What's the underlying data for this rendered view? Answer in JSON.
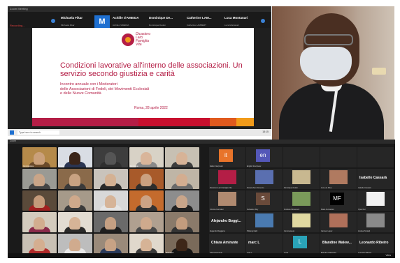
{
  "top_window": {
    "title": "Zoom Meeting",
    "recording": "Recording...",
    "strip": [
      {
        "name": "Michaela Fikar",
        "sub": "Michaela Fikar"
      },
      {
        "name": "M",
        "sub": "Valentino Negreti"
      },
      {
        "name": "Achille d'AMEIDA",
        "sub": "Achille d'AMEIDA"
      },
      {
        "name": "Dominique De...",
        "sub": "Dominique Dedon"
      },
      {
        "name": "Catherine LAM...",
        "sub": "Catherine LAMBERT"
      },
      {
        "name": "Luca Montanari",
        "sub": "Luca Montanari"
      }
    ],
    "slide": {
      "logo_line1": "Dicastero",
      "logo_line2": "Laici",
      "logo_line3": "Famiglia",
      "logo_line4": "Vita",
      "title": "Condizioni lavorative all'interno delle associazioni. Un servizio secondo giustizia e carità",
      "subtitle_1": "Incontro annuale con i Moderatori",
      "subtitle_2": "delle Associazioni di Fedeli, dei Movimenti Ecclesiali",
      "subtitle_3": "e delle Nuove Comunità",
      "date": "Roma, 28 aprile 2022",
      "band_colors": [
        "#b41e46",
        "#c8102e",
        "#e05a1e",
        "#f19b1a"
      ]
    },
    "taskbar": {
      "search": "Type here to search",
      "clock": "18:15"
    }
  },
  "priest_feed": {
    "name": ""
  },
  "gallery": {
    "title": "Zoom",
    "video_tiles": [
      {
        "label": "Commissione",
        "bg": "#b58a4a",
        "face": "#caa07a",
        "shirt": "#6a4a2a"
      },
      {
        "label": "Francis",
        "bg": "#d9dde4",
        "face": "#3a2418",
        "shirt": "#2a3552"
      },
      {
        "label": "",
        "bg": "#3d3d3d",
        "face": "#555555",
        "shirt": "#2f2f2f"
      },
      {
        "label": "Dominique",
        "bg": "#d8d2c6",
        "face": "#d9b59a",
        "shirt": "#8a8a8a"
      },
      {
        "label": "",
        "bg": "#c7c0b3",
        "face": "#d7b397",
        "shirt": "#3d3d3d"
      },
      {
        "label": "",
        "bg": "#9a9a94",
        "face": "#c9a588",
        "shirt": "#444444"
      },
      {
        "label": "",
        "bg": "#8a6a4a",
        "face": "#c8a282",
        "shirt": "#3a3a3a"
      },
      {
        "label": "",
        "bg": "#c9c3bb",
        "face": "#d4b193",
        "shirt": "#2a2a2a"
      },
      {
        "label": "",
        "bg": "#a85a2a",
        "face": "#caa080",
        "shirt": "#2d2d2d"
      },
      {
        "label": "",
        "bg": "#bfb5a6",
        "face": "#d3ad90",
        "shirt": "#6a6a6a"
      },
      {
        "label": "",
        "bg": "#5a4a3a",
        "face": "#c49a7a",
        "shirt": "#a02020"
      },
      {
        "label": "",
        "bg": "#a69a8a",
        "face": "#cfa98b",
        "shirt": "#3b3b3b"
      },
      {
        "label": "",
        "bg": "#d8d8d8",
        "face": "#d6b498",
        "shirt": "#e4e4e4"
      },
      {
        "label": "",
        "bg": "#c46b2d",
        "face": "#cca385",
        "shirt": "#333333"
      },
      {
        "label": "",
        "bg": "#8d8d8d",
        "face": "#c8a58a",
        "shirt": "#222222"
      },
      {
        "label": "",
        "bg": "#d3cbbd",
        "face": "#d2ad8f",
        "shirt": "#8a2a4a"
      },
      {
        "label": "",
        "bg": "#e2dcd2",
        "face": "#d7b497",
        "shirt": "#2a2a2a"
      },
      {
        "label": "",
        "bg": "#6a6a6a",
        "face": "#c5a083",
        "shirt": "#1f1f1f"
      },
      {
        "label": "",
        "bg": "#b0a090",
        "face": "#cfaa8d",
        "shirt": "#4a4a4a"
      },
      {
        "label": "",
        "bg": "#8a7a6a",
        "face": "#c29c7e",
        "shirt": "#333333"
      },
      {
        "label": "",
        "bg": "#c8c0b4",
        "face": "#d4ae90",
        "shirt": "#b02a2a"
      },
      {
        "label": "",
        "bg": "#bdbdbd",
        "face": "#d0ab8e",
        "shirt": "#e8e8e8"
      },
      {
        "label": "",
        "bg": "#9a8a7a",
        "face": "#c7a285",
        "shirt": "#2a3a5a"
      },
      {
        "label": "",
        "bg": "#e0d8cc",
        "face": "#d6b396",
        "shirt": "#3a3a3a"
      },
      {
        "label": "Abdenago",
        "bg": "#7a6a5a",
        "face": "#3d2618",
        "shirt": "#151515"
      }
    ],
    "participant_tiles": [
      {
        "kind": "square",
        "text": "it",
        "color": "#e8742a",
        "label": "Italian Interpreter"
      },
      {
        "kind": "square",
        "text": "en",
        "color": "#5457b8",
        "label": "English Interpreter"
      },
      {
        "kind": "empty",
        "label": ""
      },
      {
        "kind": "empty",
        "label": ""
      },
      {
        "kind": "empty",
        "label": ""
      },
      {
        "kind": "logo",
        "color": "#b41e46",
        "label": "Dicastero Laici Famiglia Vita"
      },
      {
        "kind": "logo",
        "color": "#5a6fb0",
        "label": "Società San Vincenzo"
      },
      {
        "kind": "logo",
        "color": "#c8b890",
        "label": "Dominique Dedon"
      },
      {
        "kind": "logo",
        "color": "#b07a60",
        "label": "Irene de Silva"
      },
      {
        "kind": "name",
        "text": "Isabelle Cassarà",
        "label": "Isabelle Cassarà"
      },
      {
        "kind": "logo",
        "color": "#b08a70",
        "label": "Cristina Gonzalez"
      },
      {
        "kind": "square",
        "text": "S",
        "color": "#6a4a3a",
        "label": "Sebastien Roy"
      },
      {
        "kind": "logo",
        "color": "#7a9a5a",
        "label": "Focolare Movement"
      },
      {
        "kind": "square",
        "text": "MF",
        "color": "#000000",
        "label": "Maria Fernandez"
      },
      {
        "kind": "logo",
        "color": "#f2f2f2",
        "label": "Opus Dei"
      },
      {
        "kind": "name",
        "text": "Alejandro Boggi...",
        "label": "Alejandro Boggiano"
      },
      {
        "kind": "logo",
        "color": "#4a7ab0",
        "label": "Hillsong Faith"
      },
      {
        "kind": "logo",
        "color": "#e0d8a0",
        "label": "Communauté"
      },
      {
        "kind": "logo",
        "color": "#b0705a",
        "label": "Carmen Lopez"
      },
      {
        "kind": "logo",
        "color": "#8a8a8a",
        "label": "Andrea Tornielli"
      },
      {
        "kind": "name",
        "text": "Chiara Amirante",
        "label": "Chiara Amirante"
      },
      {
        "kind": "name",
        "text": "marc L",
        "label": "marc L"
      },
      {
        "kind": "square",
        "text": "L",
        "color": "#2aa3b8",
        "label": "Lucia"
      },
      {
        "kind": "name",
        "text": "Blandine Walew...",
        "label": "Blandine Walewska"
      },
      {
        "kind": "name",
        "text": "Leonardo Ribeiro",
        "label": "Leonardo Ribeiro"
      }
    ],
    "controls_text": "View"
  }
}
